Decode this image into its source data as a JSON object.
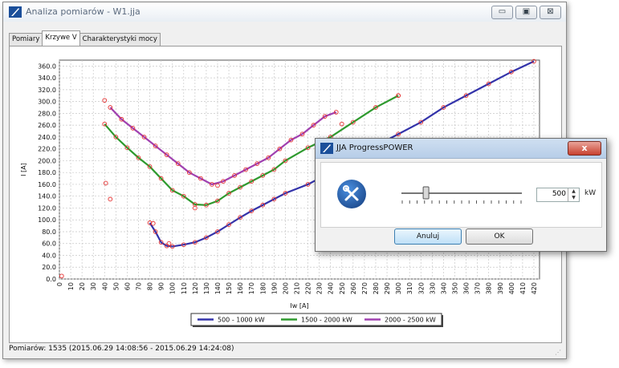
{
  "window": {
    "title": "Analiza pomiarów - W1.jja",
    "controls": {
      "minimize": "▭",
      "maximize": "▣",
      "close": "⊠"
    },
    "tabs": [
      {
        "label": "Pomiary",
        "active": false
      },
      {
        "label": "Krzywe V",
        "active": true
      },
      {
        "label": "Charakterystyki mocy",
        "active": false
      }
    ],
    "status": "Pomiarów: 1535 (2015.06.29 14:08:56 - 2015.06.29 14:24:08)"
  },
  "colors": {
    "series1": "#3333aa",
    "series2": "#2e9a2e",
    "series3": "#a040b0",
    "markers": "#e53030"
  },
  "chart_data": {
    "type": "line",
    "xlabel": "Iw [A]",
    "ylabel": "I [A]",
    "xlim": [
      0,
      425
    ],
    "ylim": [
      0,
      370
    ],
    "xticks": [
      0,
      10,
      20,
      30,
      40,
      50,
      60,
      70,
      80,
      90,
      100,
      110,
      120,
      130,
      140,
      150,
      160,
      170,
      180,
      190,
      200,
      210,
      220,
      230,
      240,
      250,
      260,
      270,
      280,
      290,
      300,
      310,
      320,
      330,
      340,
      350,
      360,
      370,
      380,
      390,
      400,
      410,
      420
    ],
    "yticks": [
      0,
      20,
      40,
      60,
      80,
      100,
      120,
      140,
      160,
      180,
      200,
      220,
      240,
      260,
      280,
      300,
      320,
      340,
      360
    ],
    "ytick_labels": [
      "0.0",
      "20.0",
      "40.0",
      "60.0",
      "80.0",
      "100.0",
      "120.0",
      "140.0",
      "160.0",
      "180.0",
      "200.0",
      "220.0",
      "240.0",
      "260.0",
      "280.0",
      "300.0",
      "320.0",
      "340.0",
      "360.0"
    ],
    "grid": true,
    "legend_position": "bottom",
    "series": [
      {
        "name": "500 - 1000 kW",
        "color": "#3333aa",
        "x": [
          80,
          85,
          90,
          95,
          100,
          110,
          120,
          130,
          140,
          150,
          160,
          170,
          180,
          190,
          200,
          220,
          240,
          260,
          280,
          300,
          320,
          340,
          360,
          380,
          400,
          420
        ],
        "y": [
          95,
          80,
          62,
          56,
          55,
          58,
          62,
          70,
          80,
          92,
          104,
          115,
          125,
          135,
          145,
          160,
          180,
          205,
          225,
          245,
          265,
          290,
          310,
          330,
          350,
          368
        ]
      },
      {
        "name": "1500 - 2000 kW",
        "color": "#2e9a2e",
        "x": [
          40,
          50,
          60,
          70,
          80,
          90,
          100,
          110,
          120,
          130,
          140,
          150,
          160,
          170,
          180,
          190,
          200,
          220,
          240,
          260,
          280,
          300
        ],
        "y": [
          262,
          240,
          222,
          205,
          190,
          170,
          150,
          140,
          126,
          125,
          132,
          145,
          155,
          165,
          175,
          185,
          200,
          222,
          240,
          265,
          290,
          310
        ]
      },
      {
        "name": "2000 - 2500 kW",
        "color": "#a040b0",
        "x": [
          45,
          55,
          65,
          75,
          85,
          95,
          105,
          115,
          125,
          135,
          145,
          155,
          165,
          175,
          185,
          195,
          205,
          215,
          225,
          235,
          245
        ],
        "y": [
          290,
          270,
          255,
          240,
          225,
          210,
          195,
          180,
          170,
          160,
          165,
          175,
          185,
          195,
          205,
          220,
          235,
          245,
          260,
          275,
          282
        ]
      }
    ],
    "markers": [
      {
        "x": 2,
        "y": 5
      },
      {
        "x": 40,
        "y": 302
      },
      {
        "x": 41,
        "y": 162
      },
      {
        "x": 45,
        "y": 135
      },
      {
        "x": 83,
        "y": 94
      },
      {
        "x": 120,
        "y": 120
      },
      {
        "x": 97,
        "y": 60
      },
      {
        "x": 140,
        "y": 158
      },
      {
        "x": 250,
        "y": 262
      },
      {
        "x": 300,
        "y": 310
      }
    ]
  },
  "dialog": {
    "title": "JJA ProgressPOWER",
    "close_label": "x",
    "icon": "tools-icon",
    "slider_value": 500,
    "slider_min": 0,
    "slider_max": 2500,
    "value_text": "500",
    "unit": "kW",
    "cancel_label": "Anuluj",
    "ok_label": "OK"
  }
}
